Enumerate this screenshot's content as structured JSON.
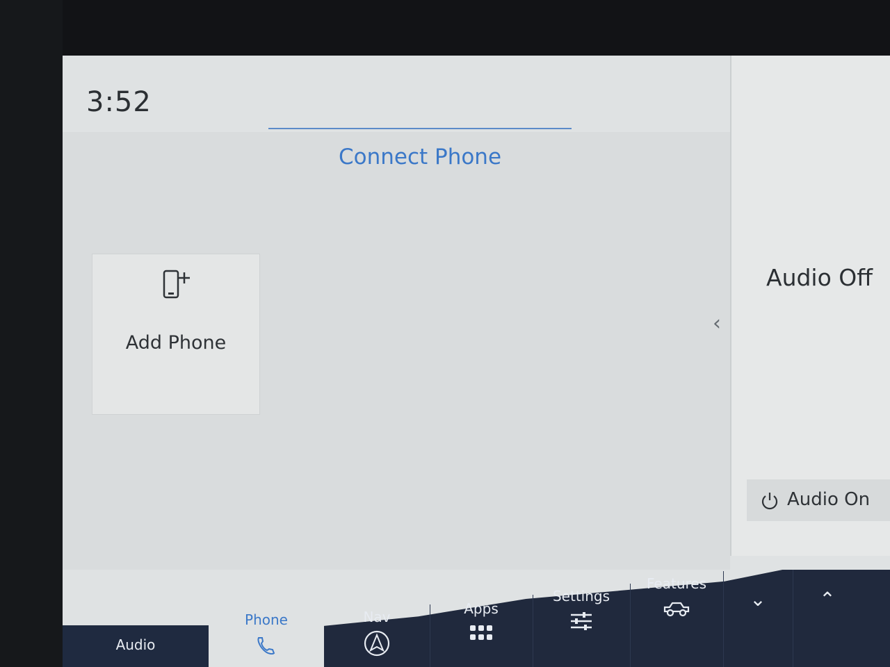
{
  "status_bar": {
    "time": "3:52",
    "icon": "signal-icon"
  },
  "main": {
    "title": "Connect Phone",
    "add_phone": {
      "label": "Add Phone",
      "icon": "add-phone-icon"
    },
    "collapse_icon": "‹"
  },
  "audio_panel": {
    "status": "Audio Off",
    "button_label": "Audio On",
    "button_icon": "power-icon"
  },
  "navbar": {
    "items": [
      {
        "label": "Audio",
        "icon": ""
      },
      {
        "label": "Phone",
        "icon": "phone-icon"
      },
      {
        "label": "Nav",
        "icon": "navigation-arrow-icon"
      },
      {
        "label": "Apps",
        "icon": "apps-grid-icon"
      },
      {
        "label": "Settings",
        "icon": "sliders-icon"
      },
      {
        "label": "Features",
        "icon": "truck-icon"
      }
    ],
    "down_icon": "⌄",
    "up_icon": "⌃"
  },
  "colors": {
    "accent": "#3b78c8",
    "screen_bg": "#dfe2e3",
    "navbar_bg": "#20293d",
    "text": "#2b2f33"
  }
}
